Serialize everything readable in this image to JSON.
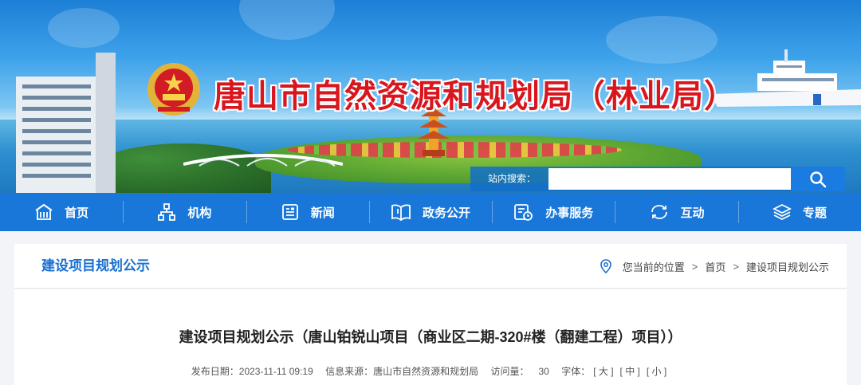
{
  "header": {
    "site_title": "唐山市自然资源和规划局（林业局）",
    "search_label": "站内搜索：",
    "search_placeholder": ""
  },
  "nav": {
    "items": [
      {
        "label": "首页",
        "icon": "home-icon"
      },
      {
        "label": "机构",
        "icon": "org-chart-icon"
      },
      {
        "label": "新闻",
        "icon": "news-icon"
      },
      {
        "label": "政务公开",
        "icon": "open-book-icon"
      },
      {
        "label": "办事服务",
        "icon": "service-icon"
      },
      {
        "label": "互动",
        "icon": "interaction-icon"
      },
      {
        "label": "专题",
        "icon": "layers-icon"
      }
    ]
  },
  "breadcrumb": {
    "section_title": "建设项目规划公示",
    "current_prefix": "您当前的位置",
    "separator": ">",
    "home": "首页",
    "current": "建设项目规划公示"
  },
  "article": {
    "title": "建设项目规划公示（唐山铂锐山项目（商业区二期-320#楼（翻建工程）项目））",
    "publish_label": "发布日期：",
    "publish_date": "2023-11-11 09:19",
    "source_label": "信息来源：",
    "source": "唐山市自然资源和规划局",
    "visits_label": "访问量：",
    "visits": "30",
    "font_label": "字体：",
    "font_large": "[ 大 ]",
    "font_medium": "[ 中 ]",
    "font_small": "[ 小 ]"
  },
  "colors": {
    "nav_bg": "#1877d8",
    "title_red": "#d9161d",
    "section_blue": "#1a6fcf"
  }
}
